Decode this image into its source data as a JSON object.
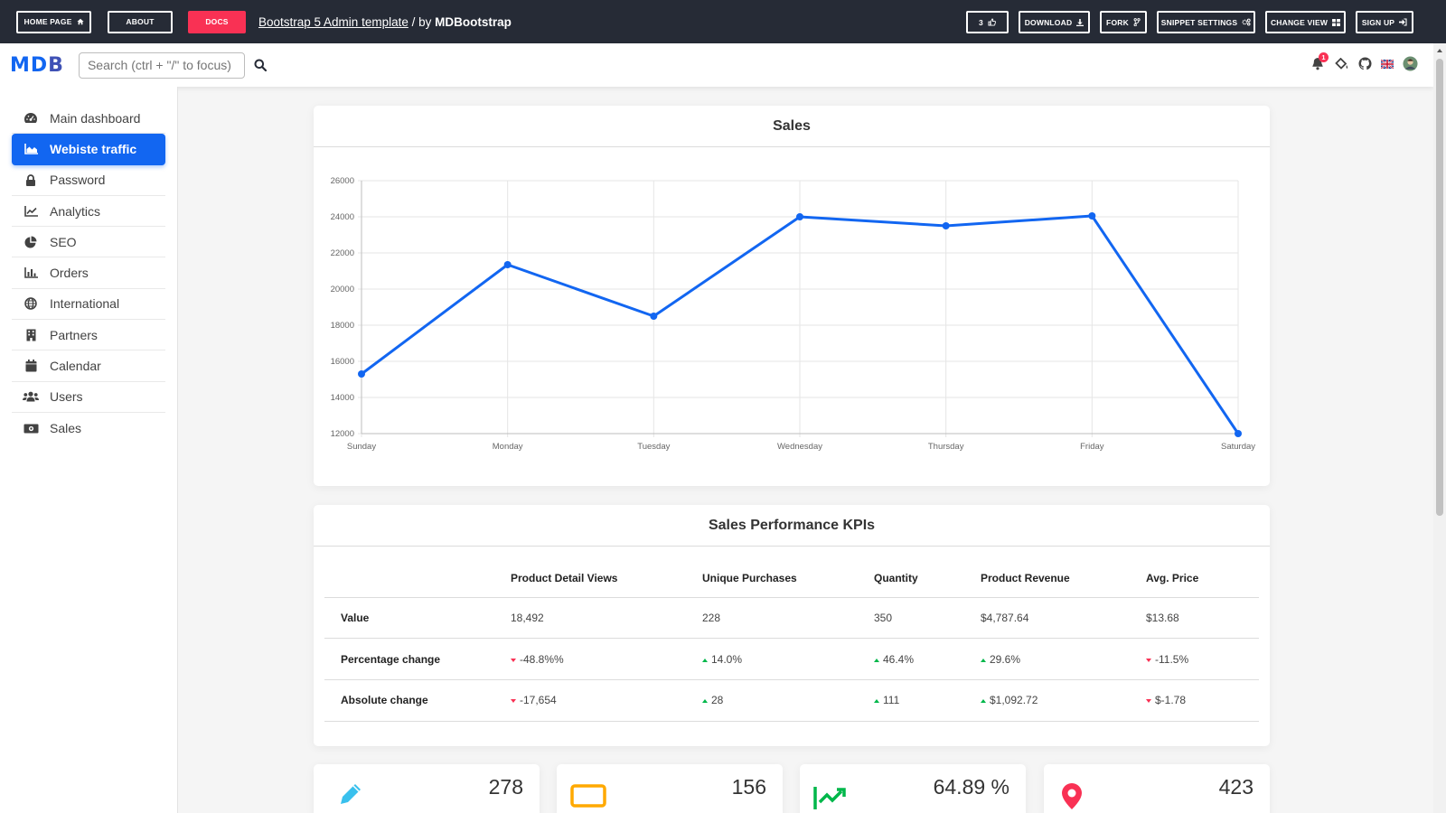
{
  "topbar": {
    "left_buttons": [
      {
        "label": "HOME PAGE",
        "icon": "home-icon"
      },
      {
        "label": "ABOUT"
      },
      {
        "label": "DOCS"
      }
    ],
    "title_link": "Bootstrap 5 Admin template",
    "title_by": " / by ",
    "title_brand": "MDBootstrap",
    "right_buttons": [
      {
        "label": "3",
        "icon": "thumbs-up-icon"
      },
      {
        "label": "DOWNLOAD",
        "icon": "download-icon"
      },
      {
        "label": "FORK",
        "icon": "code-branch-icon"
      },
      {
        "label": "SNIPPET SETTINGS",
        "icon": "cogs-icon"
      },
      {
        "label": "CHANGE VIEW",
        "icon": "grid-icon"
      },
      {
        "label": "SIGN UP",
        "icon": "sign-in-icon"
      }
    ]
  },
  "navbar": {
    "logo": "MDB",
    "search_placeholder": "Search (ctrl + \"/\" to focus)",
    "notification_count": "1"
  },
  "sidebar": {
    "items": [
      {
        "label": "Main dashboard",
        "icon": "tachometer-icon",
        "active": false
      },
      {
        "label": "Webiste traffic",
        "icon": "area-chart-icon",
        "active": true
      },
      {
        "label": "Password",
        "icon": "lock-icon",
        "active": false
      },
      {
        "label": "Analytics",
        "icon": "line-chart-icon",
        "active": false
      },
      {
        "label": "SEO",
        "icon": "pie-chart-icon",
        "active": false
      },
      {
        "label": "Orders",
        "icon": "bar-chart-icon",
        "active": false
      },
      {
        "label": "International",
        "icon": "globe-icon",
        "active": false
      },
      {
        "label": "Partners",
        "icon": "building-icon",
        "active": false
      },
      {
        "label": "Calendar",
        "icon": "calendar-icon",
        "active": false
      },
      {
        "label": "Users",
        "icon": "users-icon",
        "active": false
      },
      {
        "label": "Sales",
        "icon": "money-bill-icon",
        "active": false
      }
    ]
  },
  "sales_card": {
    "title": "Sales"
  },
  "chart_data": {
    "type": "line",
    "title": "Sales",
    "categories": [
      "Sunday",
      "Monday",
      "Tuesday",
      "Wednesday",
      "Thursday",
      "Friday",
      "Saturday"
    ],
    "values": [
      15300,
      21350,
      18500,
      24000,
      23500,
      24050,
      12000
    ],
    "ylim": [
      12000,
      26000
    ],
    "yticks": [
      12000,
      14000,
      16000,
      18000,
      20000,
      22000,
      24000,
      26000
    ],
    "grid": true,
    "color": "#1266f1"
  },
  "kpi_card": {
    "title": "Sales Performance KPIs",
    "columns": [
      "",
      "Product Detail Views",
      "Unique Purchases",
      "Quantity",
      "Product Revenue",
      "Avg. Price"
    ],
    "rows": [
      {
        "label": "Value",
        "cells": [
          {
            "text": "18,492"
          },
          {
            "text": "228"
          },
          {
            "text": "350"
          },
          {
            "text": "$4,787.64"
          },
          {
            "text": "$13.68"
          }
        ]
      },
      {
        "label": "Percentage change",
        "cells": [
          {
            "text": "-48.8%%",
            "trend": "down"
          },
          {
            "text": "14.0%",
            "trend": "up"
          },
          {
            "text": "46.4%",
            "trend": "up"
          },
          {
            "text": "29.6%",
            "trend": "up"
          },
          {
            "text": "-11.5%",
            "trend": "down"
          }
        ]
      },
      {
        "label": "Absolute change",
        "cells": [
          {
            "text": "-17,654",
            "trend": "down"
          },
          {
            "text": "28",
            "trend": "up"
          },
          {
            "text": "111",
            "trend": "up"
          },
          {
            "text": "$1,092.72",
            "trend": "up"
          },
          {
            "text": "$-1.78",
            "trend": "down"
          }
        ]
      }
    ]
  },
  "stats": [
    {
      "value": "278",
      "icon": "pencil-icon",
      "color": "#39c0ed"
    },
    {
      "value": "156",
      "icon": "comment-icon",
      "color": "#ffa900"
    },
    {
      "value": "64.89 %",
      "icon": "chart-up-icon",
      "color": "#00b74a"
    },
    {
      "value": "423",
      "icon": "map-marker-icon",
      "color": "#f93154"
    }
  ],
  "colors": {
    "primary": "#1266f1",
    "danger": "#f93154",
    "success": "#00b74a",
    "topbar": "#262b36"
  }
}
